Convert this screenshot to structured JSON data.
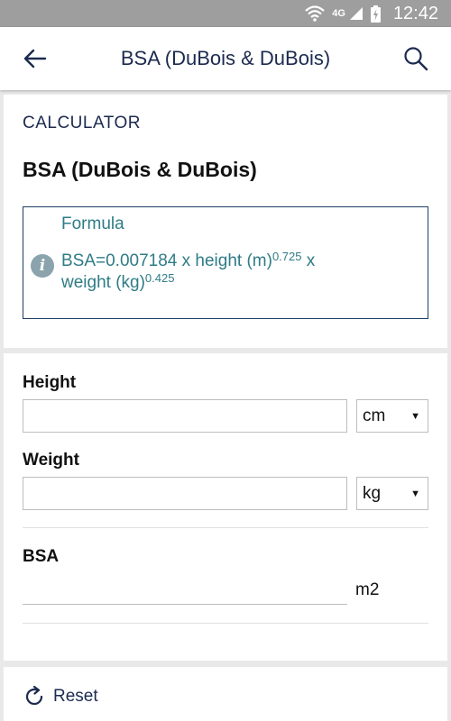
{
  "status_bar": {
    "network": "4G",
    "time": "12:42",
    "icons": [
      "wifi-icon",
      "signal-icon",
      "battery-charging-icon"
    ]
  },
  "app_bar": {
    "title": "BSA (DuBois & DuBois)",
    "back_icon": "arrow-left-icon",
    "search_icon": "search-icon"
  },
  "calculator": {
    "section_label": "CALCULATOR",
    "title": "BSA (DuBois & DuBois)",
    "formula": {
      "heading": "Formula",
      "line1_text": "BSA=0.007184 x height (m)",
      "line1_sup": "0.725",
      "line1_tail": " x",
      "line2_text": "weight (kg)",
      "line2_sup": "0.425"
    }
  },
  "inputs": {
    "height": {
      "label": "Height",
      "value": "",
      "unit": "cm"
    },
    "weight": {
      "label": "Weight",
      "value": "",
      "unit": "kg"
    }
  },
  "result": {
    "label": "BSA",
    "value": "",
    "unit": "m2"
  },
  "footer": {
    "reset_label": "Reset"
  },
  "colors": {
    "accent": "#1c2a4f",
    "formula_text": "#2f7c86",
    "status_bar": "#9e9e9e",
    "background": "#e9e9e9"
  }
}
